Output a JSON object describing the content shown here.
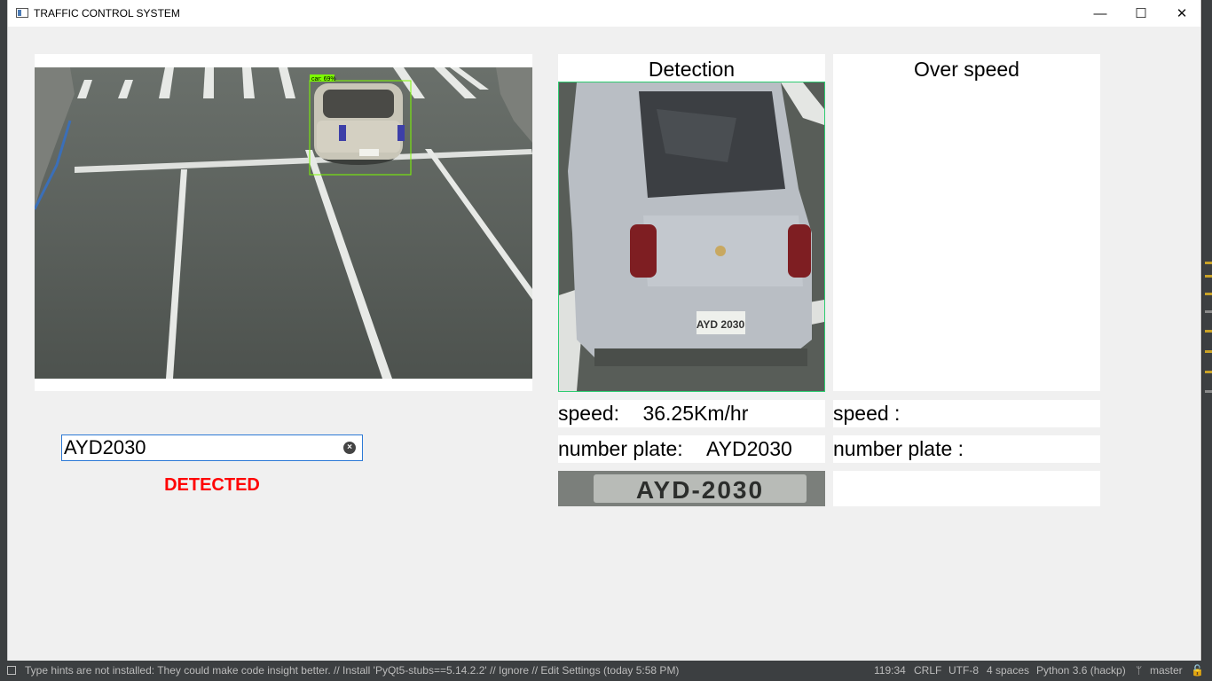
{
  "window": {
    "title": "TRAFFIC CONTROL SYSTEM",
    "minimize_glyph": "—",
    "maximize_glyph": "☐",
    "close_glyph": "✕"
  },
  "video": {
    "detection_label": "car: 69%"
  },
  "plate_input": {
    "value": "AYD2030"
  },
  "status": {
    "text": "DETECTED",
    "color": "#ff0000"
  },
  "detection_panel": {
    "title": "Detection",
    "speed_label": "speed:",
    "speed_value": "36.25Km/hr",
    "plate_label": "number plate:",
    "plate_value": "AYD2030",
    "car_plate_text": "AYD 2030",
    "crop_plate_text": "AYD-2030"
  },
  "overspeed_panel": {
    "title": "Over speed",
    "speed_label": "speed :",
    "plate_label": "number plate :"
  },
  "ide_statusbar": {
    "message": "Type hints are not installed: They could make code insight better. // Install 'PyQt5-stubs==5.14.2.2' // Ignore // Edit Settings (today 5:58 PM)",
    "position": "119:34",
    "line_sep": "CRLF",
    "encoding": "UTF-8",
    "indent": "4 spaces",
    "interpreter": "Python 3.6 (hackp)",
    "branch": "master"
  },
  "colors": {
    "window_bg": "#f0f0f0",
    "detection_box": "#7cfc00",
    "input_border": "#2d7ad6",
    "ide_dark": "#3c3f41"
  }
}
